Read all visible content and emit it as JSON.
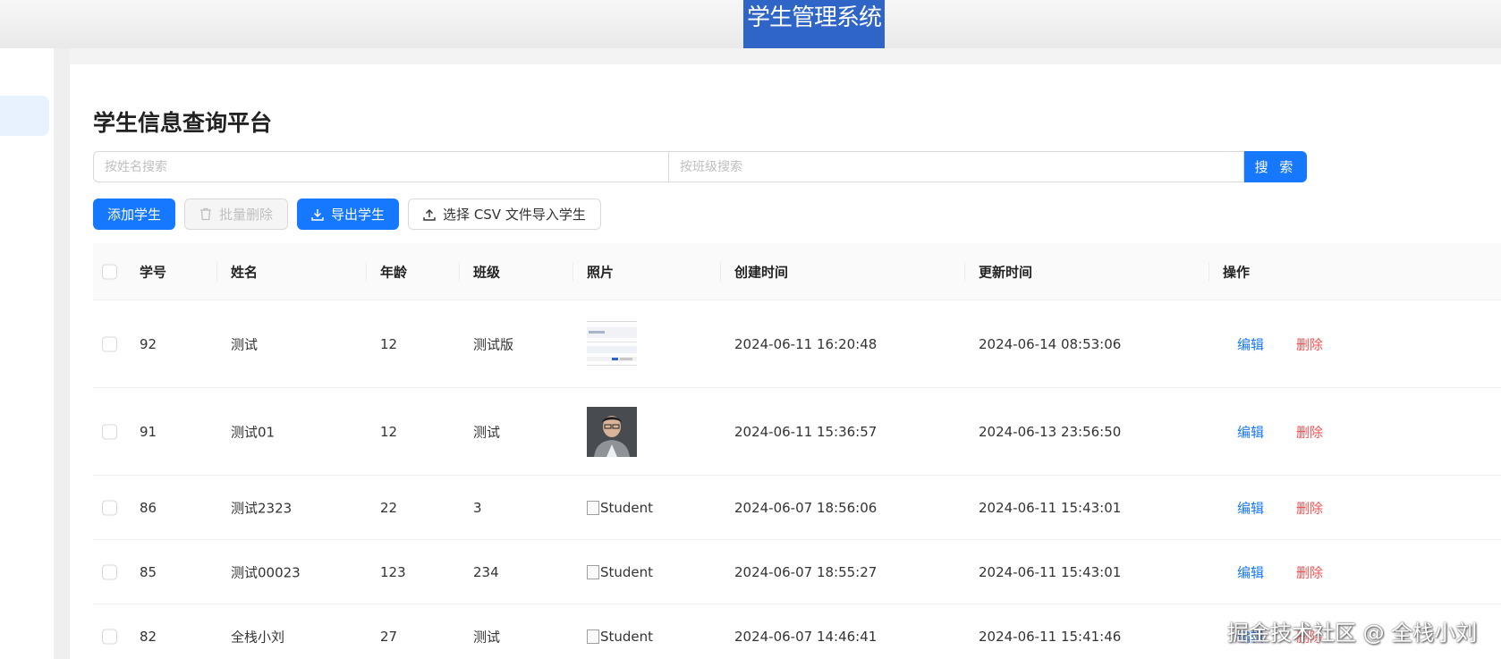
{
  "app_title": "学生管理系统",
  "page_title": "学生信息查询平台",
  "search": {
    "name_placeholder": "按姓名搜索",
    "class_placeholder": "按班级搜索",
    "button_label": "搜 索"
  },
  "toolbar": {
    "add_label": "添加学生",
    "batch_delete_label": "批量删除",
    "export_label": "导出学生",
    "import_label": "选择 CSV 文件导入学生"
  },
  "table": {
    "columns": [
      "学号",
      "姓名",
      "年龄",
      "班级",
      "照片",
      "创建时间",
      "更新时间",
      "操作"
    ],
    "rows": [
      {
        "id": "92",
        "name": "测试",
        "age": "12",
        "class": "测试版",
        "photo": "screenshot-thumbnail",
        "created": "2024-06-11 16:20:48",
        "updated": "2024-06-14 08:53:06",
        "edit": "编辑",
        "delete": "删除"
      },
      {
        "id": "91",
        "name": "测试01",
        "age": "12",
        "class": "测试",
        "photo": "portrait-thumbnail",
        "created": "2024-06-11 15:36:57",
        "updated": "2024-06-13 23:56:50",
        "edit": "编辑",
        "delete": "删除"
      },
      {
        "id": "86",
        "name": "测试2323",
        "age": "22",
        "class": "3",
        "photo_alt": "Student",
        "created": "2024-06-07 18:56:06",
        "updated": "2024-06-11 15:43:01",
        "edit": "编辑",
        "delete": "删除"
      },
      {
        "id": "85",
        "name": "测试00023",
        "age": "123",
        "class": "234",
        "photo_alt": "Student",
        "created": "2024-06-07 18:55:27",
        "updated": "2024-06-11 15:43:01",
        "edit": "编辑",
        "delete": "删除"
      },
      {
        "id": "82",
        "name": "全栈小刘",
        "age": "27",
        "class": "测试",
        "photo_alt": "Student",
        "created": "2024-06-07 14:46:41",
        "updated": "2024-06-11 15:41:46",
        "edit": "编辑",
        "delete": "删除"
      }
    ]
  },
  "watermark": "掘金技术社区 @ 全栈小刘",
  "colors": {
    "primary": "#1677ff",
    "danger": "#ff4d4f",
    "title_bar": "#2f65c6"
  }
}
